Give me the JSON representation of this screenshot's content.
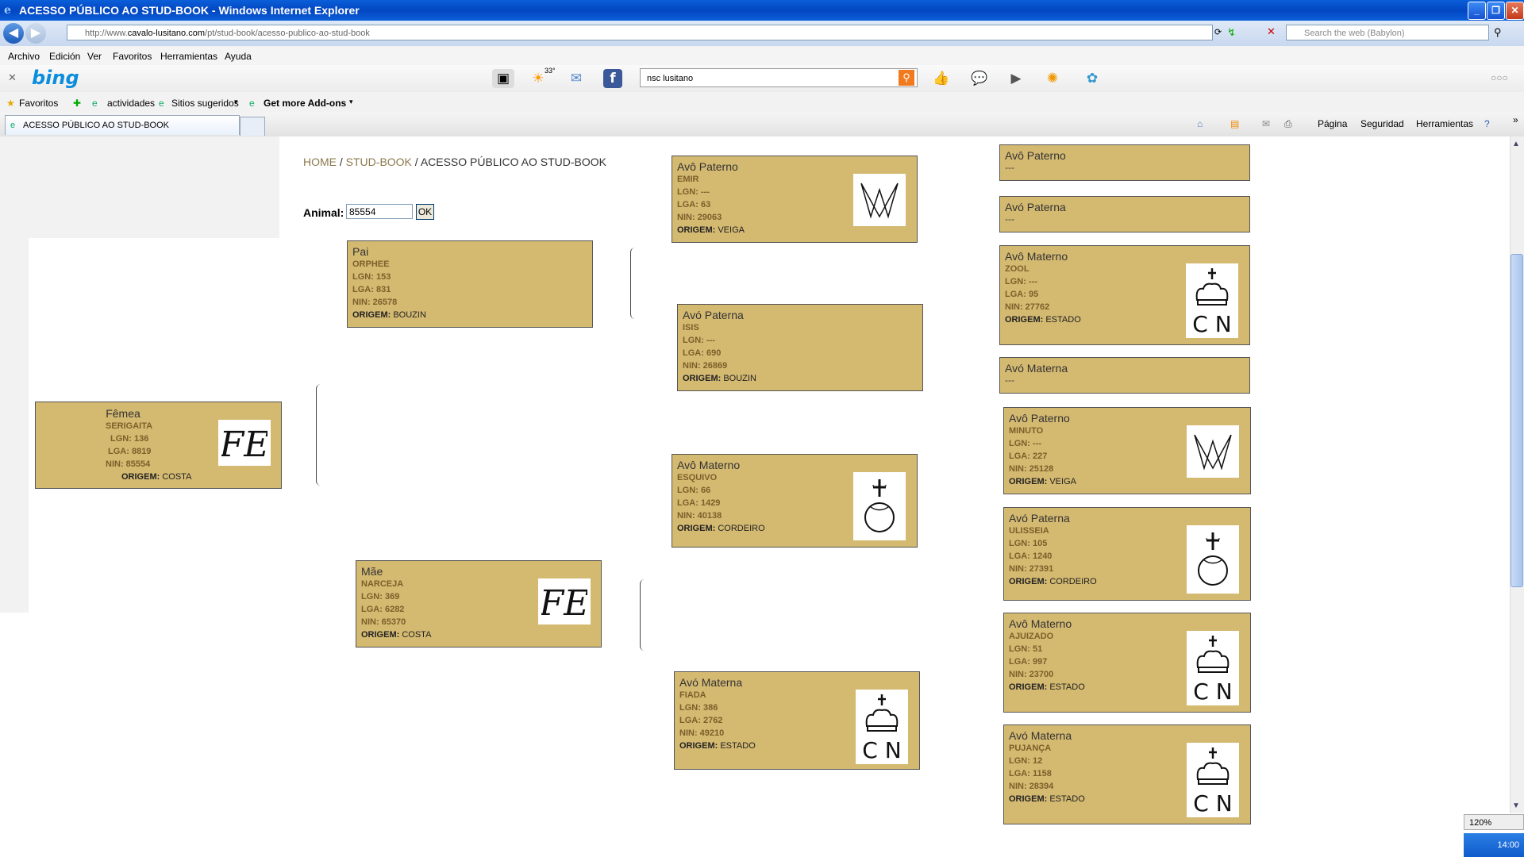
{
  "window": {
    "title": "ACESSO PÚBLICO AO STUD-BOOK - Windows Internet Explorer"
  },
  "address": {
    "url_prefix": "http://www.",
    "url_domain": "cavalo-lusitano.com",
    "url_path": "/pt/stud-book/acesso-publico-ao-stud-book",
    "search_placeholder": "Search the web (Babylon)"
  },
  "menu": [
    "Archivo",
    "Edición",
    "Ver",
    "Favoritos",
    "Herramientas",
    "Ayuda"
  ],
  "bing": {
    "logo": "bing",
    "query": "nsc lusitano",
    "temp": "33°"
  },
  "favorites": {
    "favoritos": "Favoritos",
    "actividades": "actividades",
    "sugeridos": "Sitios sugeridos",
    "addons": "Get more Add-ons"
  },
  "tab": {
    "title": "ACESSO PÚBLICO AO STUD-BOOK"
  },
  "commandbar": {
    "pagina": "Página",
    "seguridad": "Seguridad",
    "herramientas": "Herramientas"
  },
  "breadcrumb": {
    "home": "HOME",
    "sep1": " / ",
    "studbook": "STUD-BOOK",
    "sep2": " / ",
    "current": "ACESSO PÚBLICO AO STUD-BOOK"
  },
  "search": {
    "label": "Animal:",
    "value": "85554",
    "button": "OK"
  },
  "labels": {
    "lgn": "LGN:",
    "lga": "LGA:",
    "nin": "NIN:",
    "origem": "ORIGEM:"
  },
  "animal": {
    "role": "Fêmea",
    "name": "SERIGAITA",
    "lgn": "136",
    "lga": "8819",
    "nin": "85554",
    "origem": "COSTA",
    "brand": "FE"
  },
  "pai": {
    "role": "Pai",
    "name": "ORPHEE",
    "lgn": "153",
    "lga": "831",
    "nin": "26578",
    "origem": "BOUZIN"
  },
  "mae": {
    "role": "Mãe",
    "name": "NARCEJA",
    "lgn": "369",
    "lga": "6282",
    "nin": "65370",
    "origem": "COSTA",
    "brand": "FE"
  },
  "g2": [
    {
      "role": "Avô Paterno",
      "name": "EMIR",
      "lgn": "---",
      "lga": "63",
      "nin": "29063",
      "origem": "VEIGA",
      "brand": "MV"
    },
    {
      "role": "Avó Paterna",
      "name": "ISIS",
      "lgn": "---",
      "lga": "690",
      "nin": "26869",
      "origem": "BOUZIN"
    },
    {
      "role": "Avô Materno",
      "name": "ESQUIVO",
      "lgn": "66",
      "lga": "1429",
      "nin": "40138",
      "origem": "CORDEIRO",
      "brand": "cross"
    },
    {
      "role": "Avó Materna",
      "name": "FIADA",
      "lgn": "386",
      "lga": "2762",
      "nin": "49210",
      "origem": "ESTADO",
      "brand": "CN"
    }
  ],
  "g3": [
    {
      "role": "Avô Paterno",
      "empty": "---"
    },
    {
      "role": "Avó Paterna",
      "empty": "---"
    },
    {
      "role": "Avô Materno",
      "name": "ZOOL",
      "lgn": "---",
      "lga": "95",
      "nin": "27762",
      "origem": "ESTADO",
      "brand": "CN"
    },
    {
      "role": "Avó Materna",
      "empty": "---"
    },
    {
      "role": "Avô Paterno",
      "name": "MINUTO",
      "lgn": "---",
      "lga": "227",
      "nin": "25128",
      "origem": "VEIGA",
      "brand": "MV"
    },
    {
      "role": "Avó Paterna",
      "name": "ULISSEIA",
      "lgn": "105",
      "lga": "1240",
      "nin": "27391",
      "origem": "CORDEIRO",
      "brand": "cross"
    },
    {
      "role": "Avô Materno",
      "name": "AJUIZADO",
      "lgn": "51",
      "lga": "997",
      "nin": "23700",
      "origem": "ESTADO",
      "brand": "CN"
    },
    {
      "role": "Avó Materna",
      "name": "PUJANÇA",
      "lgn": "12",
      "lga": "1158",
      "nin": "28394",
      "origem": "ESTADO",
      "brand": "CN"
    }
  ],
  "status": {
    "zoom": "120%",
    "clock": "14:00"
  }
}
